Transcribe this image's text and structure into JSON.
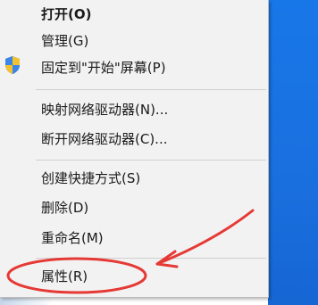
{
  "context_menu": {
    "items": [
      {
        "label": "打开(O)",
        "bold": true
      },
      {
        "label": "管理(G)",
        "icon": "uac-shield-icon"
      },
      {
        "label": "固定到\"开始\"屏幕(P)"
      },
      {
        "label": "映射网络驱动器(N)..."
      },
      {
        "label": "断开网络驱动器(C)..."
      },
      {
        "label": "创建快捷方式(S)"
      },
      {
        "label": "删除(D)"
      },
      {
        "label": "重命名(M)"
      },
      {
        "label": "属性(R)",
        "highlighted": true
      }
    ]
  },
  "annotation": {
    "color": "#e53935",
    "target": "属性(R)",
    "shape": "ellipse-with-arrow"
  },
  "colors": {
    "menu_background": "#f2f2f2",
    "desktop_blue": "#1877e8"
  }
}
